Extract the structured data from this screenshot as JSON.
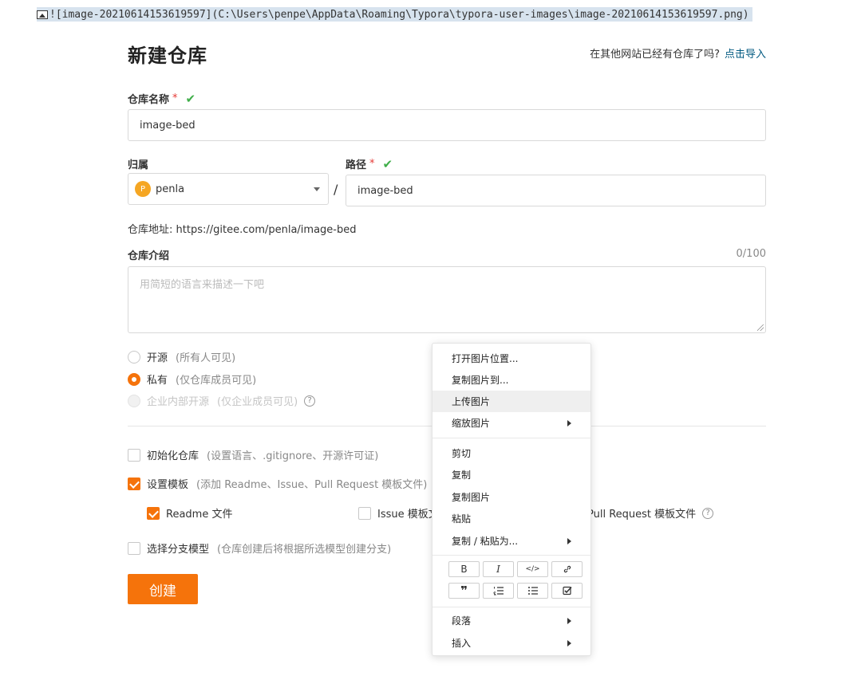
{
  "markdown_line": "![image-20210614153619597](C:\\Users\\penpe\\AppData\\Roaming\\Typora\\typora-user-images\\image-20210614153619597.png)",
  "title": "新建仓库",
  "import": {
    "text": "在其他网站已经有仓库了吗?",
    "link": "点击导入"
  },
  "repo_name": {
    "label": "仓库名称",
    "required": "*",
    "value": "image-bed"
  },
  "owner": {
    "label": "归属",
    "avatar_letter": "P",
    "value": "penla"
  },
  "path": {
    "label": "路径",
    "required": "*",
    "separator": "/",
    "value": "image-bed"
  },
  "repo_url": {
    "label": "仓库地址:",
    "value": "https://gitee.com/penla/image-bed"
  },
  "intro": {
    "label": "仓库介绍",
    "counter": "0/100",
    "placeholder": "用简短的语言来描述一下吧"
  },
  "visibility": [
    {
      "label": "开源",
      "hint": "(所有人可见)",
      "state": "off"
    },
    {
      "label": "私有",
      "hint": "(仅仓库成员可见)",
      "state": "on"
    },
    {
      "label": "企业内部开源",
      "hint": "(仅企业成员可见)",
      "state": "disabled"
    }
  ],
  "init_repo": {
    "label": "初始化仓库",
    "hint": "(设置语言、.gitignore、开源许可证)",
    "checked": false
  },
  "set_template": {
    "label": "设置模板",
    "hint": "(添加 Readme、Issue、Pull Request 模板文件)",
    "checked": true
  },
  "templates": [
    {
      "label": "Readme 文件",
      "checked": true
    },
    {
      "label": "Issue 模板文件",
      "checked": false
    },
    {
      "label": "Pull Request 模板文件",
      "checked": false
    }
  ],
  "branch_model": {
    "label": "选择分支模型",
    "hint": "(仓库创建后将根据所选模型创建分支)",
    "checked": false
  },
  "create_button": "创建",
  "context_menu": {
    "items": [
      "打开图片位置...",
      "复制图片到...",
      "上传图片",
      "缩放图片",
      "剪切",
      "复制",
      "复制图片",
      "粘贴",
      "复制 / 粘贴为...",
      "段落",
      "插入"
    ],
    "format_buttons": [
      "B",
      "I",
      "</>",
      "link",
      "quote",
      "ordered-list",
      "bullet-list",
      "task-list"
    ]
  },
  "colors": {
    "accent": "#f5730b",
    "check": "#3fae49",
    "link": "#005980",
    "required": "#e53935"
  }
}
